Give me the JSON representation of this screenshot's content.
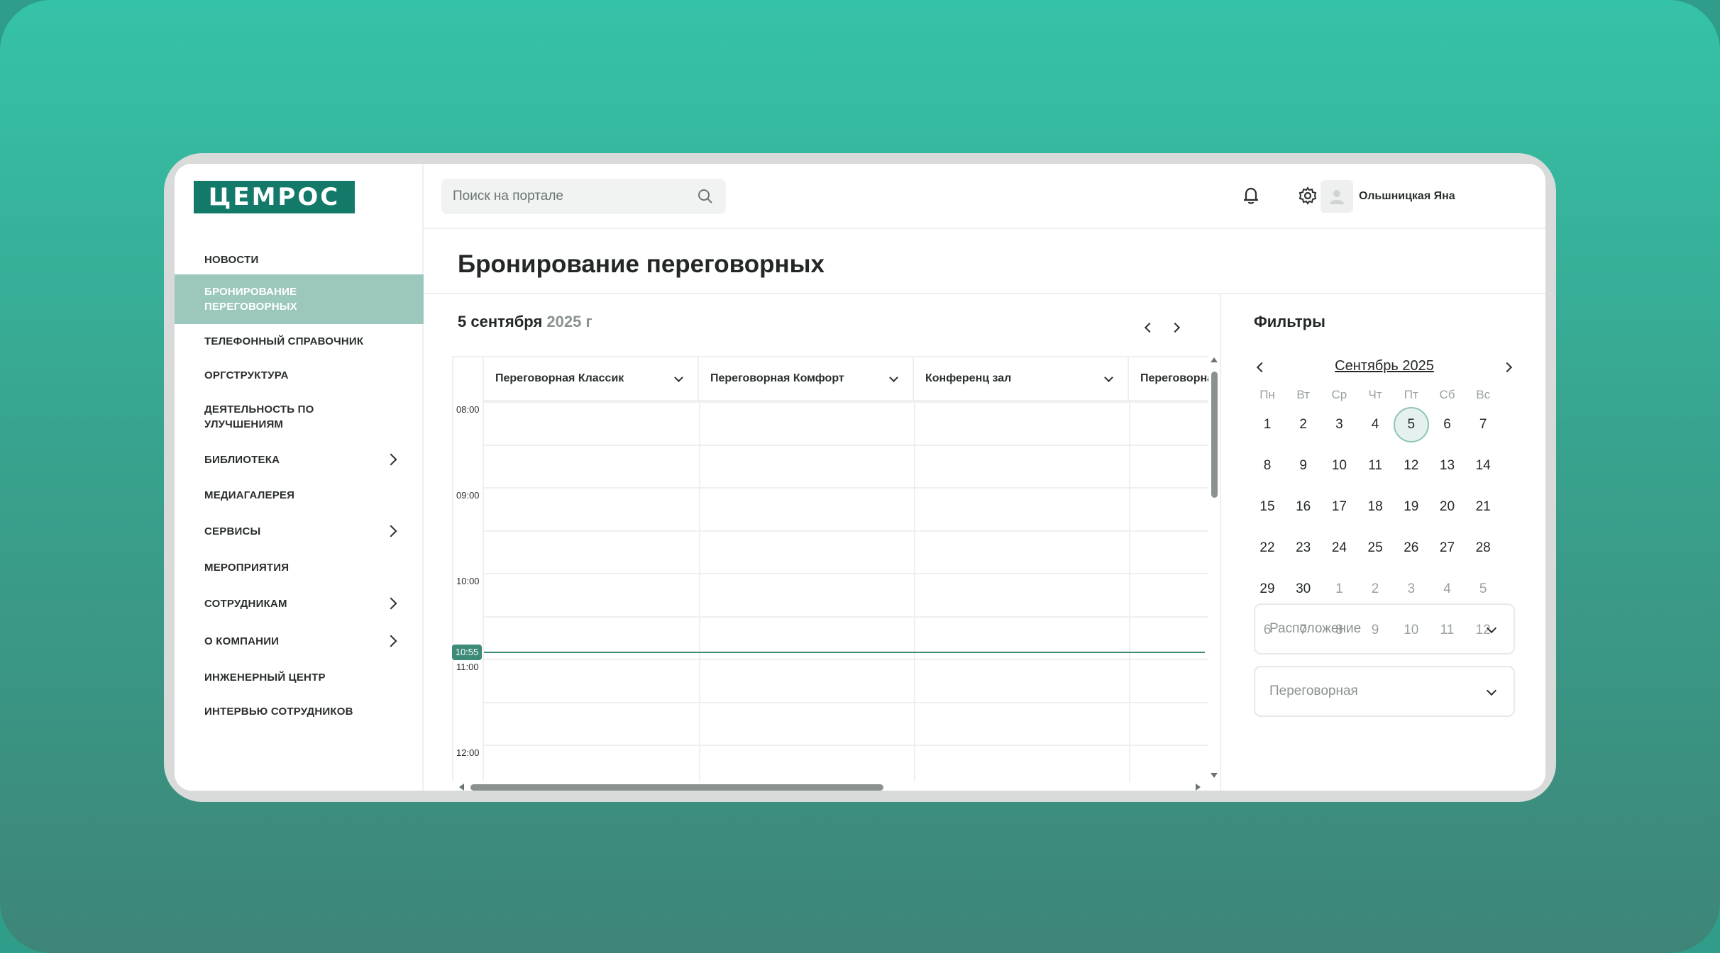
{
  "brand": {
    "logo_text": "ЦЕМРОС"
  },
  "sidebar": {
    "items": [
      {
        "label": "НОВОСТИ",
        "active": false,
        "has_children": false
      },
      {
        "label": "БРОНИРОВАНИЕ ПЕРЕГОВОРНЫХ",
        "active": true,
        "has_children": false
      },
      {
        "label": "ТЕЛЕФОННЫЙ СПРАВОЧНИК",
        "active": false,
        "has_children": false
      },
      {
        "label": "ОРГСТРУКТУРА",
        "active": false,
        "has_children": false
      },
      {
        "label": "ДЕЯТЕЛЬНОСТЬ ПО УЛУЧШЕНИЯМ",
        "active": false,
        "has_children": false
      },
      {
        "label": "БИБЛИОТЕКА",
        "active": false,
        "has_children": true
      },
      {
        "label": "МЕДИАГАЛЕРЕЯ",
        "active": false,
        "has_children": false
      },
      {
        "label": "СЕРВИСЫ",
        "active": false,
        "has_children": true
      },
      {
        "label": "МЕРОПРИЯТИЯ",
        "active": false,
        "has_children": false
      },
      {
        "label": "СОТРУДНИКАМ",
        "active": false,
        "has_children": true
      },
      {
        "label": "О КОМПАНИИ",
        "active": false,
        "has_children": true
      },
      {
        "label": "ИНЖЕНЕРНЫЙ ЦЕНТР",
        "active": false,
        "has_children": false
      },
      {
        "label": "ИНТЕРВЬЮ СОТРУДНИКОВ",
        "active": false,
        "has_children": false
      }
    ]
  },
  "header": {
    "search_placeholder": "Поиск на портале",
    "user_name": "Ольшницкая Яна",
    "icons": [
      "search-icon",
      "bell-icon",
      "gear-icon",
      "user-icon",
      "chevron-down-icon"
    ]
  },
  "page": {
    "title": "Бронирование переговорных"
  },
  "schedule": {
    "date_main": "5 сентября",
    "date_year": "2025 г",
    "rooms": [
      "Переговорная Классик",
      "Переговорная Комфорт",
      "Конференц зал",
      "Переговорная"
    ],
    "times": [
      "08:00",
      "09:00",
      "10:00",
      "11:00",
      "12:00"
    ],
    "now": "10:55"
  },
  "filters": {
    "title": "Фильтры",
    "calendar": {
      "month": "Сентябрь 2025",
      "weekdays": [
        "Пн",
        "Вт",
        "Ср",
        "Чт",
        "Пт",
        "Сб",
        "Вс"
      ],
      "weeks": [
        [
          "1",
          "2",
          "3",
          "4",
          "5",
          "6",
          "7"
        ],
        [
          "8",
          "9",
          "10",
          "11",
          "12",
          "13",
          "14"
        ],
        [
          "15",
          "16",
          "17",
          "18",
          "19",
          "20",
          "21"
        ],
        [
          "22",
          "23",
          "24",
          "25",
          "26",
          "27",
          "28"
        ],
        [
          "29",
          "30",
          "1",
          "2",
          "3",
          "4",
          "5"
        ],
        [
          "6",
          "7",
          "8",
          "9",
          "10",
          "11",
          "12"
        ]
      ],
      "selected_day": "5"
    },
    "location_placeholder": "Расположение",
    "room_placeholder": "Переговорная"
  },
  "colors": {
    "accent": "#137a6a",
    "active_nav": "#9bc7bd",
    "now_line": "#3d8a78"
  }
}
